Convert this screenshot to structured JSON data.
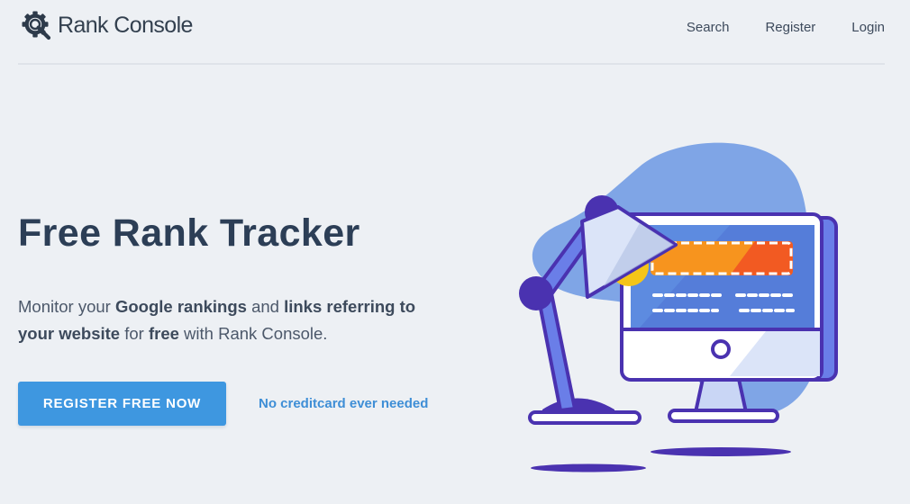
{
  "header": {
    "brand_name": "Rank Console",
    "nav": [
      {
        "label": "Search"
      },
      {
        "label": "Register"
      },
      {
        "label": "Login"
      }
    ]
  },
  "hero": {
    "title": "Free Rank Tracker",
    "description": {
      "t1": "Monitor your ",
      "b1": "Google rankings",
      "t2": " and ",
      "b2": "links referring to your website",
      "t3": " for ",
      "b3": "free",
      "t4": " with Rank Console."
    },
    "cta_label": "REGISTER FREE NOW",
    "cta_note": "No creditcard ever needed"
  },
  "colors": {
    "background": "#edf0f4",
    "primary_button": "#3e97e0",
    "link": "#3e8ed6",
    "heading": "#2c3e56",
    "illustration_purple": "#4a32b0",
    "illustration_blob": "#7fa5e6",
    "illustration_orange": "#f7941e"
  },
  "icons": {
    "logo": "gear-magnifier-icon"
  }
}
